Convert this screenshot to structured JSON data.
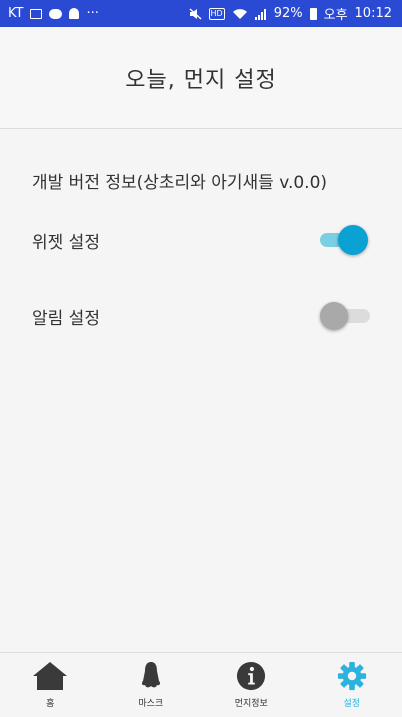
{
  "statusbar": {
    "carrier": "KT",
    "more": "···",
    "hd": "HD",
    "battery_percent": "92%",
    "ampm": "오후",
    "time": "10:12"
  },
  "header": {
    "title": "오늘, 먼지 설정"
  },
  "settings": {
    "version_info": "개발 버전 정보(상초리와 아기새들 v.0.0)",
    "widget": {
      "label": "위젯 설정",
      "enabled": true
    },
    "alarm": {
      "label": "알림 설정",
      "enabled": false
    }
  },
  "bottom_nav": {
    "items": [
      {
        "label": "홈",
        "icon": "home-icon"
      },
      {
        "label": "마스크",
        "icon": "mask-icon"
      },
      {
        "label": "먼지정보",
        "icon": "info-icon"
      },
      {
        "label": "설정",
        "icon": "gear-icon",
        "active": true
      }
    ]
  },
  "colors": {
    "statusbar_bg": "#2b4ad3",
    "switch_on_thumb": "#0aa1d3",
    "switch_on_track": "#7ccfe0",
    "switch_off_thumb": "#a9a9a9",
    "active_nav": "#2bb3dd",
    "nav_icon": "#3a3a3a"
  }
}
